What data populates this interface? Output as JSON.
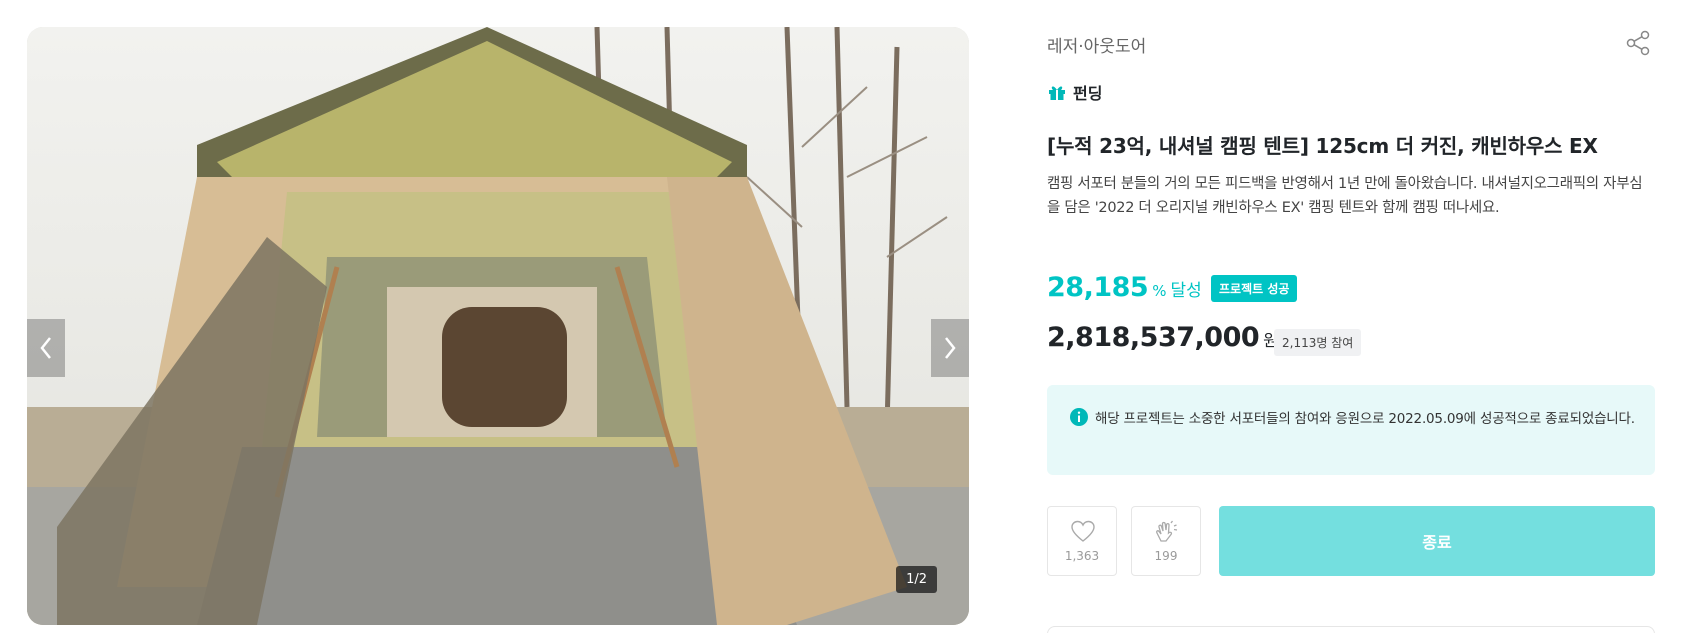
{
  "gallery": {
    "counter": "1/2",
    "prev_icon": "chevron-left-icon",
    "next_icon": "chevron-right-icon"
  },
  "project": {
    "category": "레저·아웃도어",
    "type_label": "펀딩",
    "title": "[누적 23억, 내셔널 캠핑 텐트] 125cm 더 커진, 캐빈하우스 EX",
    "description": "캠핑 서포터 분들의 거의 모든 피드백을 반영해서 1년 만에 돌아왔습니다. 내셔널지오그래픽의 자부심을 담은 '2022 더 오리지널 캐빈하우스 EX' 캠핑 텐트와 함께 캠핑 떠나세요."
  },
  "stats": {
    "achievement_rate": "28,185",
    "rate_unit": "%",
    "rate_label": "달성",
    "status_badge": "프로젝트 성공",
    "amount": "2,818,537,000",
    "amount_unit": "원",
    "supporters": "2,113명 참여"
  },
  "notice": {
    "text": "해당 프로젝트는 소중한 서포터들의 참여와 응원으로 2022.05.09에 성공적으로 종료되었습니다."
  },
  "actions": {
    "like_count": "1,363",
    "cheer_count": "199",
    "end_label": "종료"
  },
  "colors": {
    "accent": "#00c4c4",
    "button_disabled": "#74dfdf",
    "notice_bg": "#e7f9f9"
  },
  "icons": {
    "share": "share-icon",
    "gift": "gift-icon",
    "info": "info-icon",
    "heart": "heart-icon",
    "clap": "clap-icon"
  }
}
